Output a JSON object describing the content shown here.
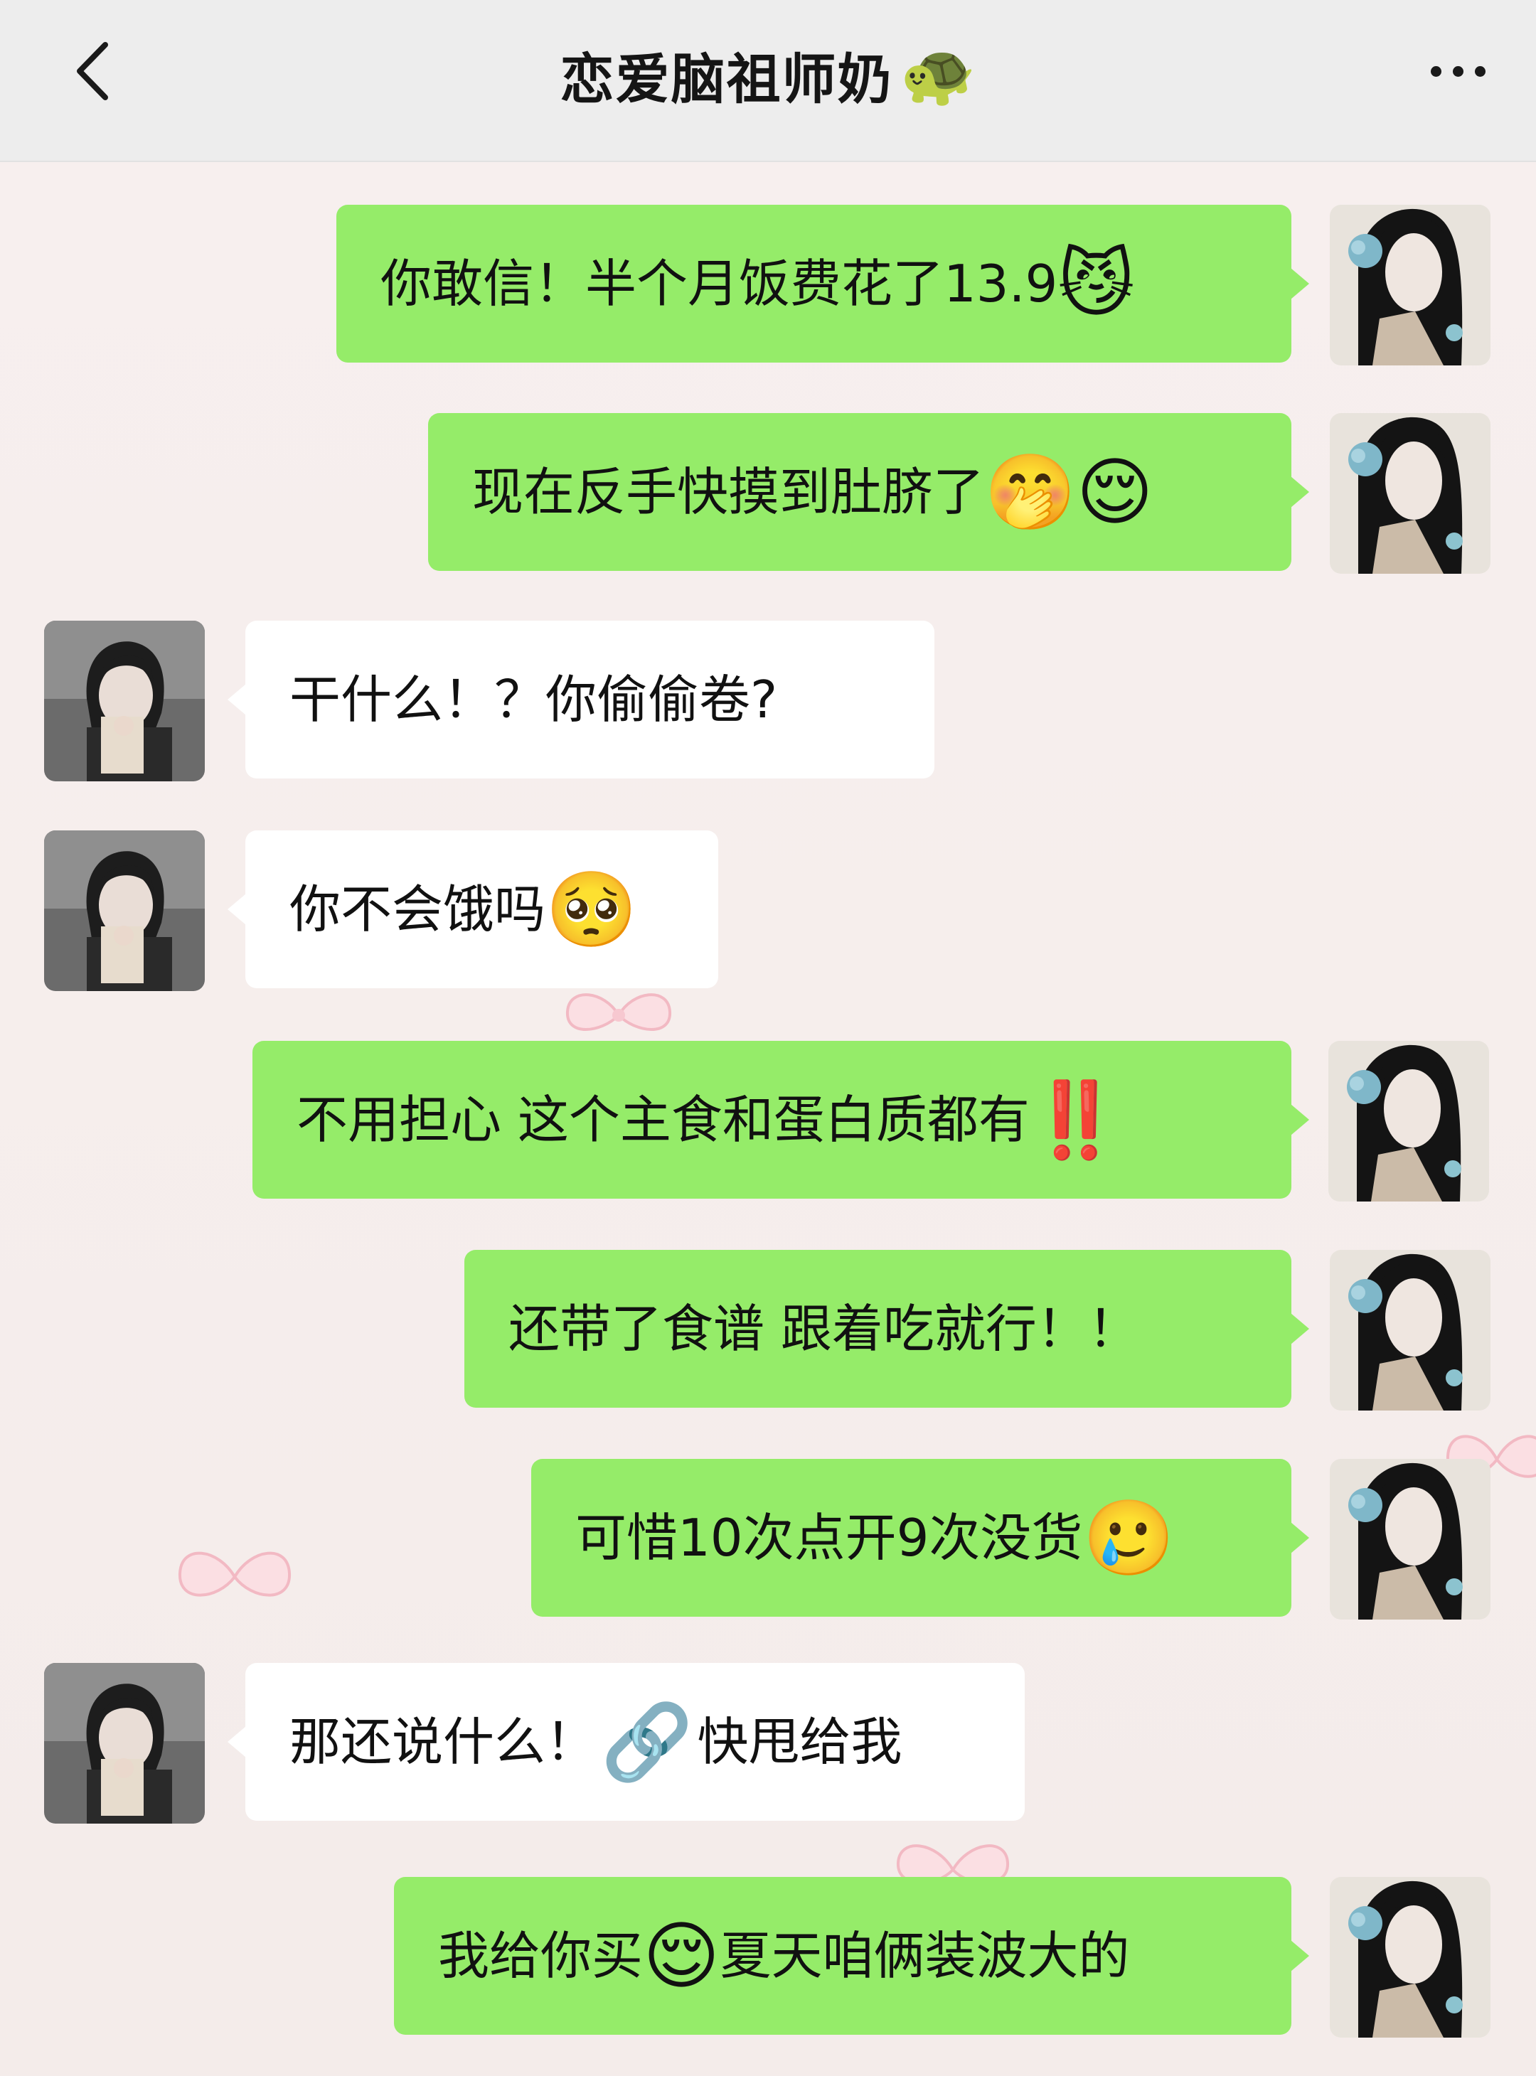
{
  "header": {
    "title": "恋爱脑祖师奶",
    "title_emoji": "🐢"
  },
  "messages": [
    {
      "side": "me",
      "text": "你敢信！半个月饭费花了13.9",
      "emoji": "😼"
    },
    {
      "side": "me",
      "text": "现在反手快摸到肚脐了",
      "emoji": "🤭😌"
    },
    {
      "side": "them",
      "text": "干什么！？你偷偷卷?",
      "emoji": ""
    },
    {
      "side": "them",
      "text": "你不会饿吗",
      "emoji": "🥺"
    },
    {
      "side": "me",
      "text": "不用担心 这个主食和蛋白质都有",
      "emoji": "‼️"
    },
    {
      "side": "me",
      "text": "还带了食谱 跟着吃就行！！",
      "emoji": ""
    },
    {
      "side": "me",
      "text": "可惜10次点开9次没货",
      "emoji": "🥲"
    },
    {
      "side": "them",
      "text": "那还说什么！",
      "emoji": "🔗",
      "text_after": "快甩给我"
    },
    {
      "side": "me",
      "text": "我给你买",
      "emoji": "😌",
      "text_after": "夏天咱俩装波大的"
    }
  ],
  "colors": {
    "my_bubble": "#95ec69",
    "their_bubble": "#ffffff",
    "background": "#f6eeec",
    "header": "#ededed"
  },
  "icons": {
    "back": "chevron-left-icon",
    "more": "more-dots-icon"
  }
}
